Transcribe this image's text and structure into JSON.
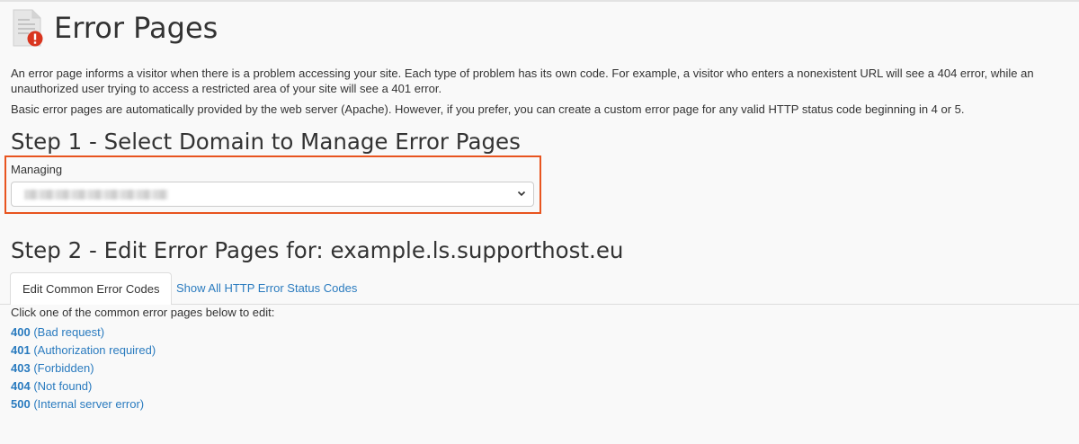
{
  "header": {
    "title": "Error Pages",
    "icon": "error-page-icon"
  },
  "description": {
    "paragraph1": "An error page informs a visitor when there is a problem accessing your site. Each type of problem has its own code. For example, a visitor who enters a nonexistent URL will see a 404 error, while an unauthorized user trying to access a restricted area of your site will see a 401 error.",
    "paragraph2": "Basic error pages are automatically provided by the web server (Apache). However, if you prefer, you can create a custom error page for any valid HTTP status code beginning in 4 or 5."
  },
  "step1": {
    "title": "Step 1 - Select Domain to Manage Error Pages",
    "managing_label": "Managing",
    "selected_domain": "",
    "highlight_color": "#e8541f"
  },
  "step2": {
    "title": "Step 2 - Edit Error Pages for: example.ls.supporthost.eu",
    "tabs": [
      {
        "label": "Edit Common Error Codes",
        "active": true
      },
      {
        "label": "Show All HTTP Error Status Codes",
        "active": false
      }
    ],
    "instructions": "Click one of the common error pages below to edit:",
    "errors": [
      {
        "code": "400",
        "desc": "(Bad request)"
      },
      {
        "code": "401",
        "desc": "(Authorization required)"
      },
      {
        "code": "403",
        "desc": "(Forbidden)"
      },
      {
        "code": "404",
        "desc": "(Not found)"
      },
      {
        "code": "500",
        "desc": "(Internal server error)"
      }
    ]
  },
  "colors": {
    "link": "#2a7bbf",
    "text": "#333333",
    "background": "#f9f9f9",
    "alert": "#d9351f"
  }
}
